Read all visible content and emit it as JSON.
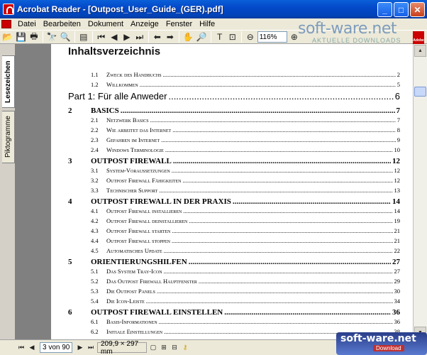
{
  "window": {
    "title": "Acrobat Reader - [Outpost_User_Guide_(GER).pdf]",
    "minimize": "_",
    "maximize": "□",
    "close": "✕"
  },
  "menu": [
    "Datei",
    "Bearbeiten",
    "Dokument",
    "Anzeige",
    "Fenster",
    "Hilfe"
  ],
  "toolbar": {
    "zoom": "116%",
    "icons": [
      "open-icon",
      "save-icon",
      "print-icon",
      "find-icon",
      "find-next-icon",
      "show-hide-icon",
      "first-page-icon",
      "prev-page-icon",
      "next-page-icon",
      "last-page-icon",
      "go-back-icon",
      "go-forward-icon",
      "hand-icon",
      "zoom-icon",
      "text-select-icon",
      "snapshot-icon",
      "zoom-out-icon",
      "zoom-in-icon",
      "adobe-icon"
    ]
  },
  "watermark": {
    "main": "soft-ware.net",
    "sub": "AKTUELLE DOWNLOADS"
  },
  "left_tabs": {
    "bookmarks": "Lesezeichen",
    "thumbnails": "Piktogramme"
  },
  "toc": {
    "heading": "Inhaltsverzeichnis",
    "entries": [
      {
        "num": "1.1",
        "title": "Zweck des Handbuchs",
        "page": "2",
        "level": "sec"
      },
      {
        "num": "1.2",
        "title": "Willkommen",
        "page": "5",
        "level": "sec"
      },
      {
        "num": "",
        "title": "Part 1: Für alle Anweder",
        "page": "6",
        "level": "part"
      },
      {
        "num": "2",
        "title": "BASICS",
        "page": "7",
        "level": "chap"
      },
      {
        "num": "2.1",
        "title": "Netzwerk Basics",
        "page": "7",
        "level": "sec"
      },
      {
        "num": "2.2",
        "title": "Wie arbeitet das Internet",
        "page": "8",
        "level": "sec"
      },
      {
        "num": "2.3",
        "title": "Gefahren im Internet",
        "page": "9",
        "level": "sec"
      },
      {
        "num": "2.4",
        "title": "Windows Terminologie",
        "page": "10",
        "level": "sec"
      },
      {
        "num": "3",
        "title": "OUTPOST FIREWALL",
        "page": "12",
        "level": "chap"
      },
      {
        "num": "3.1",
        "title": "System-Voraussetzungen",
        "page": "12",
        "level": "sec"
      },
      {
        "num": "3.2",
        "title": "Outpost Firewall Fähigkeiten",
        "page": "12",
        "level": "sec"
      },
      {
        "num": "3.3",
        "title": "Technischer Support",
        "page": "13",
        "level": "sec"
      },
      {
        "num": "4",
        "title": "OUTPOST FIREWALL IN DER PRAXIS",
        "page": "14",
        "level": "chap"
      },
      {
        "num": "4.1",
        "title": "Outpost Firewall installieren",
        "page": "14",
        "level": "sec"
      },
      {
        "num": "4.2",
        "title": "Outpost Firewall deinstallieren",
        "page": "19",
        "level": "sec"
      },
      {
        "num": "4.3",
        "title": "Outpost Firewall starten",
        "page": "21",
        "level": "sec"
      },
      {
        "num": "4.4",
        "title": "Outpost Firewall stoppen",
        "page": "21",
        "level": "sec"
      },
      {
        "num": "4.5",
        "title": "Automatisches Update",
        "page": "22",
        "level": "sec"
      },
      {
        "num": "5",
        "title": "ORIENTIERUNGSHILFEN",
        "page": "27",
        "level": "chap"
      },
      {
        "num": "5.1",
        "title": "Das System Tray-Icon",
        "page": "27",
        "level": "sec"
      },
      {
        "num": "5.2",
        "title": "Das Outpost Firewall Hauptfenster",
        "page": "29",
        "level": "sec"
      },
      {
        "num": "5.3",
        "title": "Die Outpost Panels",
        "page": "30",
        "level": "sec"
      },
      {
        "num": "5.4",
        "title": "Die Icon-Leiste",
        "page": "34",
        "level": "sec"
      },
      {
        "num": "6",
        "title": "OUTPOST FIREWALL EINSTELLEN",
        "page": "36",
        "level": "chap"
      },
      {
        "num": "6.1",
        "title": "Basis-Informationen",
        "page": "36",
        "level": "sec"
      },
      {
        "num": "6.2",
        "title": "Initiale Einstellungen",
        "page": "38",
        "level": "sec"
      },
      {
        "num": "6.3",
        "title": "Auswahl des Security-Levels",
        "page": "40",
        "level": "sec"
      }
    ]
  },
  "status": {
    "page_field": "3 von 90",
    "page_size": "209,9 × 297 mm"
  },
  "bottom_watermark": {
    "main": "soft-ware.net",
    "sub": "Download"
  }
}
